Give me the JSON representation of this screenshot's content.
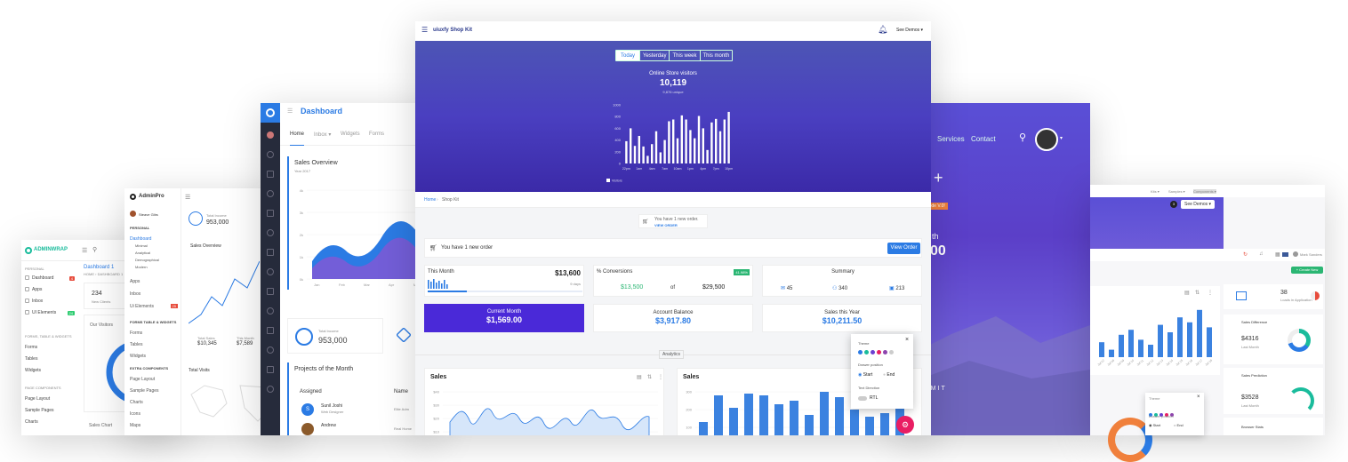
{
  "p1": {
    "brand": "ADMINWRAP",
    "title": "Dashboard 1",
    "crumb": [
      "HOME",
      "DASHBOARD 1"
    ],
    "stat_value": "234",
    "stat_label": "New Clients",
    "visitors": "Our Visitors",
    "sales_chart": "Sales Chart",
    "menu": [
      {
        "label": "Dashboard",
        "badge": "4",
        "badge_color": "#e74c3c"
      },
      {
        "label": "Apps"
      },
      {
        "label": "Inbox"
      },
      {
        "label": "UI Elements",
        "badge": "24",
        "badge_color": "#2ecc71"
      }
    ],
    "section2": "FORMS, TABLE & WIDGETS",
    "menu2": [
      "Forms",
      "Tables",
      "Widgets"
    ],
    "section3": "PAGE COMPONENTS",
    "menu3": [
      "Page Layout",
      "Sample Pages",
      "Charts"
    ]
  },
  "p2": {
    "brand": "AdminPro",
    "user": "Steave Gibs",
    "section1": "PERSONAL",
    "menu": [
      "Dashboard",
      "Minimal",
      "Analytical",
      "Demographical",
      "Modern"
    ],
    "menu_b": [
      "Apps",
      "Inbox",
      "Ui Elements"
    ],
    "ui_badge": "25",
    "section2": "FORMS TABLE & WIDGETS",
    "menu2": [
      "Forms",
      "Tables",
      "Widgets"
    ],
    "section3": "EXTRA COMPONENTS",
    "menu3": [
      "Page Layout",
      "Sample Pages",
      "Charts",
      "Icons",
      "Maps"
    ],
    "card_label": "Total Income",
    "card_value": "953,000",
    "sales": "Sales Overview",
    "ts_label": "Total Sales",
    "ts_value": "$10,345",
    "tm_label": "This Month",
    "tm_value": "$7,589",
    "visits": "Total Visits"
  },
  "p3": {
    "title": "Dashboard",
    "tabs": [
      "Home",
      "Inbox",
      "Widgets",
      "Forms"
    ],
    "sales": "Sales Overview",
    "year": "Year 2017",
    "y_ticks": [
      "4k",
      "3k",
      "2k",
      "1k",
      "0k"
    ],
    "x_ticks": [
      "Jan",
      "Feb",
      "Mar",
      "Apr",
      "May",
      "Jun"
    ],
    "income_label": "Total Income",
    "income_value": "953,000",
    "projects": "Projects of the Month",
    "col_assigned": "Assigned",
    "col_name": "Name",
    "rows": [
      {
        "name": "Sunil Joshi",
        "role": "Web Designer",
        "proj": "Elite Adm",
        "initial": "S"
      },
      {
        "name": "Andrew",
        "role": "",
        "proj": "Real Home"
      }
    ]
  },
  "p4": {
    "brand": "uiuxfy Shop Kit",
    "demos": "See Demos",
    "hero_tabs": [
      "Today",
      "Yesterday",
      "This week",
      "This month"
    ],
    "visitors_title": "Online Store visitors",
    "visitors_value": "10,119",
    "visitors_unique": "9,876 unique",
    "chart_data": {
      "type": "bar",
      "categories": [
        "22pm",
        "",
        "",
        "1am",
        "",
        "",
        "4am",
        "",
        "",
        "7am",
        "",
        "",
        "10am",
        "",
        "",
        "1pm",
        "",
        "",
        "4pm",
        "",
        "",
        "7pm",
        "",
        "",
        "10pm",
        ""
      ],
      "values": [
        380,
        600,
        300,
        470,
        290,
        130,
        330,
        550,
        190,
        400,
        720,
        750,
        430,
        820,
        750,
        570,
        430,
        810,
        600,
        230,
        700,
        760,
        550,
        750,
        880
      ],
      "y_ticks": [
        "1000",
        "800",
        "600",
        "400",
        "200",
        "0"
      ],
      "ylim": [
        0,
        1000
      ],
      "legend": "Visitors"
    },
    "crumb": [
      "Home",
      "Shop Kit"
    ],
    "notif_text": "You have 1 new order.",
    "notif_link": "VIEW ORDER",
    "order_text": "You have 1 new order",
    "order_btn": "View Order",
    "month_label": "This Month",
    "month_value": "$13,600",
    "month_days": "9 days",
    "conv_label": "% Conversions",
    "conv_pct": "41.98%",
    "conv_a": "$13,500",
    "conv_of": "of",
    "conv_b": "$29,500",
    "summary": "Summary",
    "sum_items": [
      "45",
      "340",
      "213"
    ],
    "cur_label": "Current Month",
    "cur_value": "$1,569.00",
    "bal_label": "Account Balance",
    "bal_value": "$3,917.80",
    "year_label": "Sales this Year",
    "year_value": "$10,211.50",
    "analytics": "Analytics",
    "sales_a": "Sales",
    "sales_b": "Sales",
    "line_ticks": [
      "$40",
      "$30",
      "$20",
      "$10"
    ],
    "bar_ticks": [
      "300",
      "200",
      "100"
    ],
    "theme": {
      "title": "Theme",
      "colors": [
        "#2b7be4",
        "#1abc9c",
        "#6c3fd1",
        "#e91e63",
        "#8e44ad",
        "#ccc"
      ],
      "drawer": "Drawer position",
      "start": "Start",
      "end": "End",
      "direction": "Text Direction",
      "rtl": "RTL"
    }
  },
  "p5": {
    "menu": [
      "Services",
      "Contact"
    ],
    "hero_word": "th",
    "hero_num": "00",
    "badge": "Code V.0!",
    "btn": "BMIT"
  },
  "p6": {
    "top": [
      "Kits",
      "Samples",
      "Components"
    ],
    "demos": "See Demos",
    "badge_num": "3",
    "create": "Create New",
    "stat": "38",
    "stat_label": "Loads in Application",
    "chart_data": {
      "type": "bar",
      "categories": [
        "Jul 07",
        "Jul 08",
        "Jul 09",
        "Jul 10",
        "Jul 11",
        "Jul 12",
        "Jul 13",
        "Jul 14",
        "Jul 15",
        "Jul 16",
        "Jul 17",
        "Jul 18"
      ],
      "values": [
        30,
        15,
        45,
        55,
        35,
        25,
        65,
        50,
        80,
        70,
        95,
        60
      ]
    },
    "diff_title": "Sales Difference",
    "diff_value": "$4316",
    "diff_sub": "Last Month",
    "pred_title": "Sales Prediction",
    "pred_value": "$3528",
    "pred_sub": "Last Month",
    "browser": "Browser Stats",
    "user": "Mark Sanders",
    "theme": {
      "title": "Theme",
      "drawer": "Drawer position",
      "start": "Start",
      "end": "End"
    }
  }
}
